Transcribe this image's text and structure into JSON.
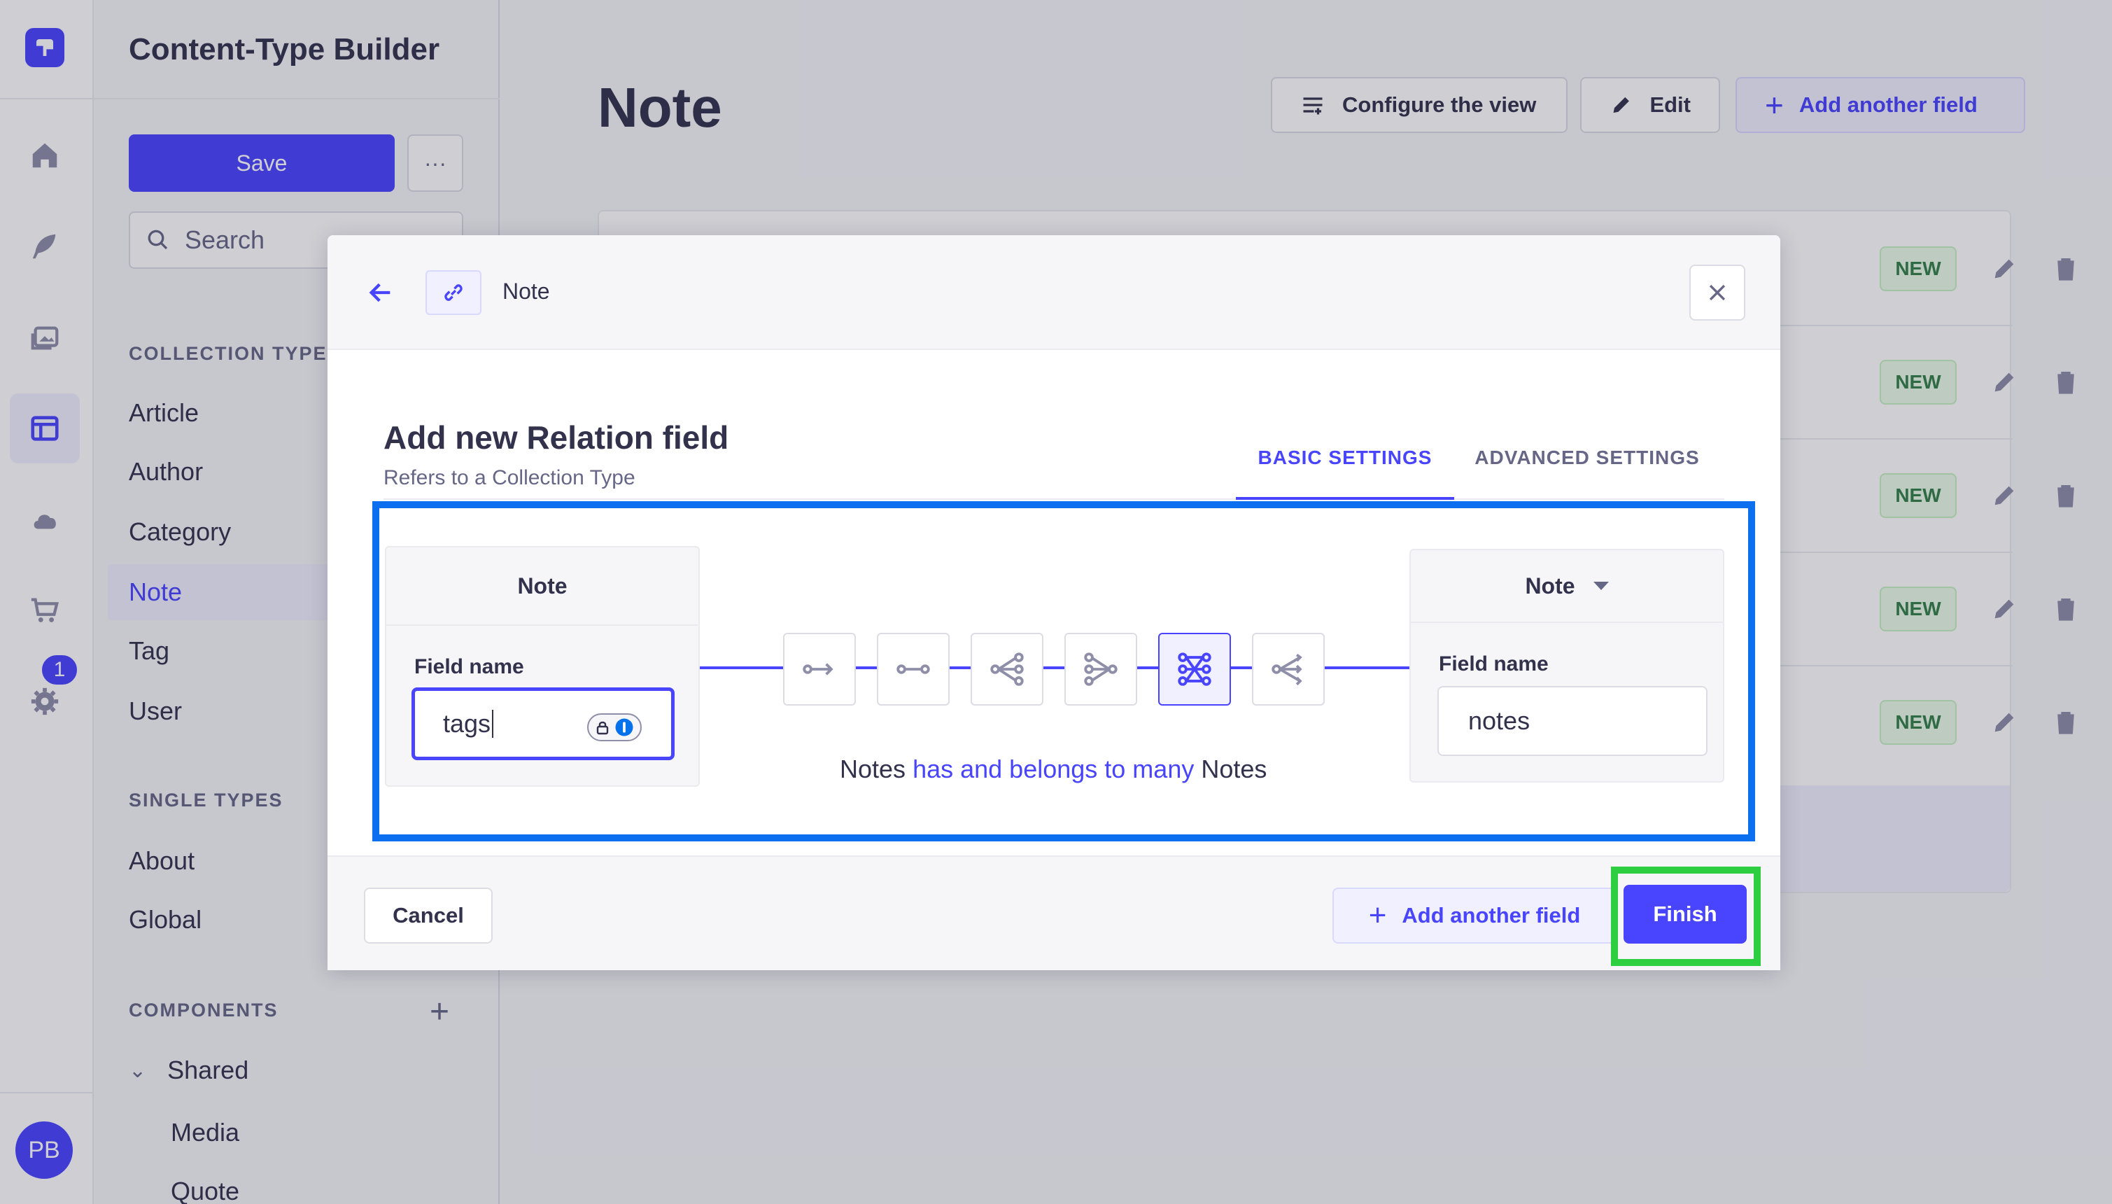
{
  "rail": {
    "notification_count": "1",
    "avatar_initials": "PB"
  },
  "sidebar": {
    "title": "Content-Type Builder",
    "save_label": "Save",
    "more_label": "···",
    "search_placeholder": "Search",
    "collection_heading": "COLLECTION TYPES",
    "collection_items": [
      "Article",
      "Author",
      "Category",
      "Note",
      "Tag",
      "User"
    ],
    "active_item": "Note",
    "single_heading": "SINGLE TYPES",
    "single_items": [
      "About",
      "Global"
    ],
    "components_heading": "COMPONENTS",
    "components_add": "+",
    "shared_label": "Shared",
    "shared_items": [
      "Media",
      "Quote"
    ]
  },
  "header": {
    "title": "Note",
    "configure_label": "Configure the view",
    "edit_label": "Edit",
    "add_field_label": "Add another field"
  },
  "table": {
    "row_badge": "NEW",
    "row_count": 5
  },
  "modal": {
    "breadcrumb": "Note",
    "title": "Add new Relation field",
    "subtitle": "Refers to a Collection Type",
    "tabs": [
      "BASIC SETTINGS",
      "ADVANCED SETTINGS"
    ],
    "active_tab": "BASIC SETTINGS",
    "left": {
      "entity": "Note",
      "field_label": "Field name",
      "field_value": "tags"
    },
    "right": {
      "entity": "Note",
      "field_label": "Field name",
      "field_value": "notes"
    },
    "relation_types": [
      "one-way",
      "one-to-one",
      "one-to-many",
      "many-to-one",
      "many-to-many",
      "many-way"
    ],
    "selected_relation": "many-to-many",
    "sentence": {
      "subject": "Notes",
      "relation": "has and belongs to many",
      "object": "Notes"
    },
    "cancel_label": "Cancel",
    "add_field_label": "Add another field",
    "finish_label": "Finish"
  },
  "colors": {
    "primary": "#4945ff",
    "highlight_frame": "#0b6ff0",
    "finish_frame": "#2dce3f",
    "new_badge": "#328048"
  }
}
